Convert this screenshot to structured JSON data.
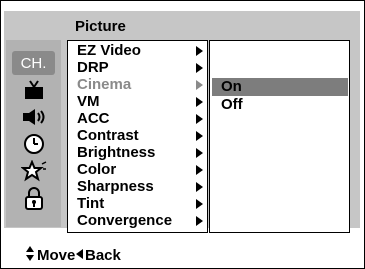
{
  "menu_title": "Picture",
  "icons": {
    "channel": "CH.",
    "tv": "tv-icon",
    "sound": "speaker-icon",
    "timer": "clock-icon",
    "special": "star-icon",
    "lock": "lock-icon"
  },
  "menu": {
    "items": [
      {
        "label": "EZ Video"
      },
      {
        "label": "DRP"
      },
      {
        "label": "Cinema"
      },
      {
        "label": "VM"
      },
      {
        "label": "ACC"
      },
      {
        "label": "Contrast"
      },
      {
        "label": "Brightness"
      },
      {
        "label": "Color"
      },
      {
        "label": "Sharpness"
      },
      {
        "label": "Tint"
      },
      {
        "label": "Convergence"
      }
    ]
  },
  "submenu": {
    "options": [
      {
        "label": "On",
        "selected": true
      },
      {
        "label": "Off",
        "selected": false
      }
    ]
  },
  "footer": {
    "move_label": "Move",
    "back_label": "Back"
  }
}
